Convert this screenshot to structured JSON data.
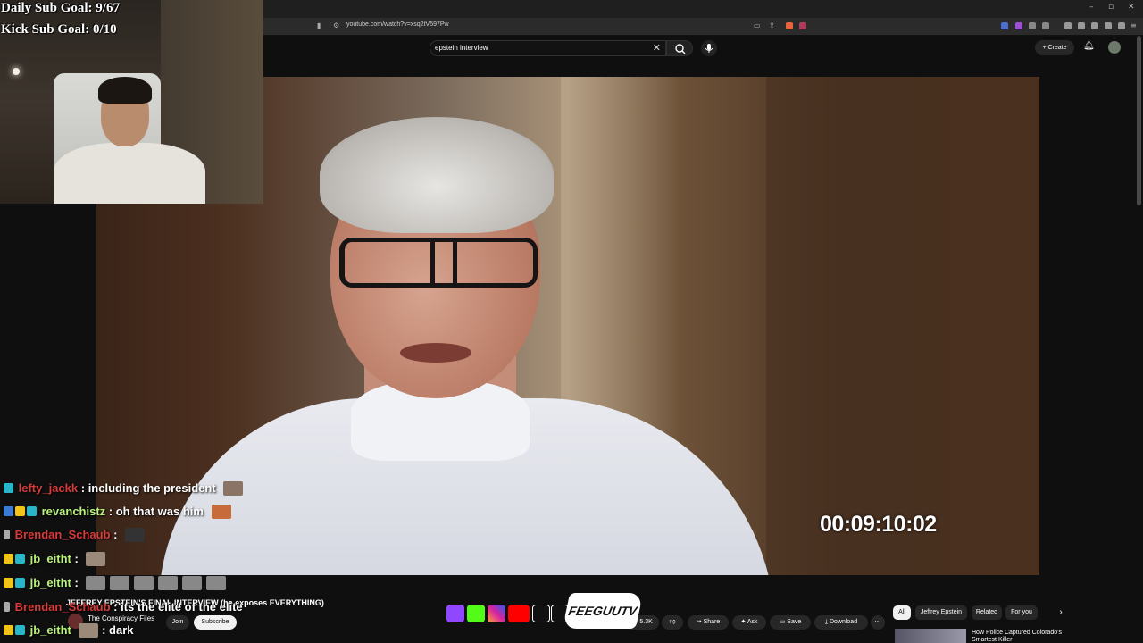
{
  "stream_overlay": {
    "daily_sub_goal": "Daily Sub Goal: 9/67",
    "kick_sub_goal": "Kick Sub Goal: 0/10",
    "chat": [
      {
        "user": "lefty_jackk",
        "message": ": including the president",
        "color": "#d93a3a"
      },
      {
        "user": "revanchistz",
        "message": ": oh that was him",
        "color": "#b9f27c"
      },
      {
        "user": "Brendan_Schaub",
        "message": ":",
        "color": "#d93a3a"
      },
      {
        "user": "jb_eitht",
        "message": ":",
        "color": "#b9f27c"
      },
      {
        "user": "jb_eitht",
        "message": ":",
        "color": "#b9f27c"
      },
      {
        "user": "Brendan_Schaub",
        "message": ": its the elite of the elite",
        "color": "#d93a3a"
      },
      {
        "user": "jb_eitht",
        "message": ": dark",
        "color": "#b9f27c"
      }
    ],
    "logo_text": "FEEGUUTV",
    "social_icons": [
      "twitch-icon",
      "kick-icon",
      "instagram-icon",
      "youtube-icon",
      "tiktok-icon",
      "x-icon"
    ]
  },
  "browser": {
    "url": "youtube.com/watch?v=xsq2tV597Pw"
  },
  "youtube": {
    "search_query": "epstein interview",
    "create_label": "Create",
    "video_timecode": "00:09:10:02",
    "video_title": "JEFFREY EPSTEIN'S FINAL INTERVIEW (he exposes EVERYTHING)",
    "channel_name": "The Conspiracy Files",
    "join_label": "Join",
    "subscribe_label": "Subscribe",
    "likes": "5.3K",
    "share_label": "Share",
    "ask_label": "Ask",
    "save_label": "Save",
    "download_label": "Download",
    "chips": [
      "All",
      "Jeffrey Epstein",
      "Related",
      "For you"
    ],
    "recommended": {
      "title_line1": "How Police Captured Colorado's",
      "title_line2": "Smartest Killer"
    }
  }
}
